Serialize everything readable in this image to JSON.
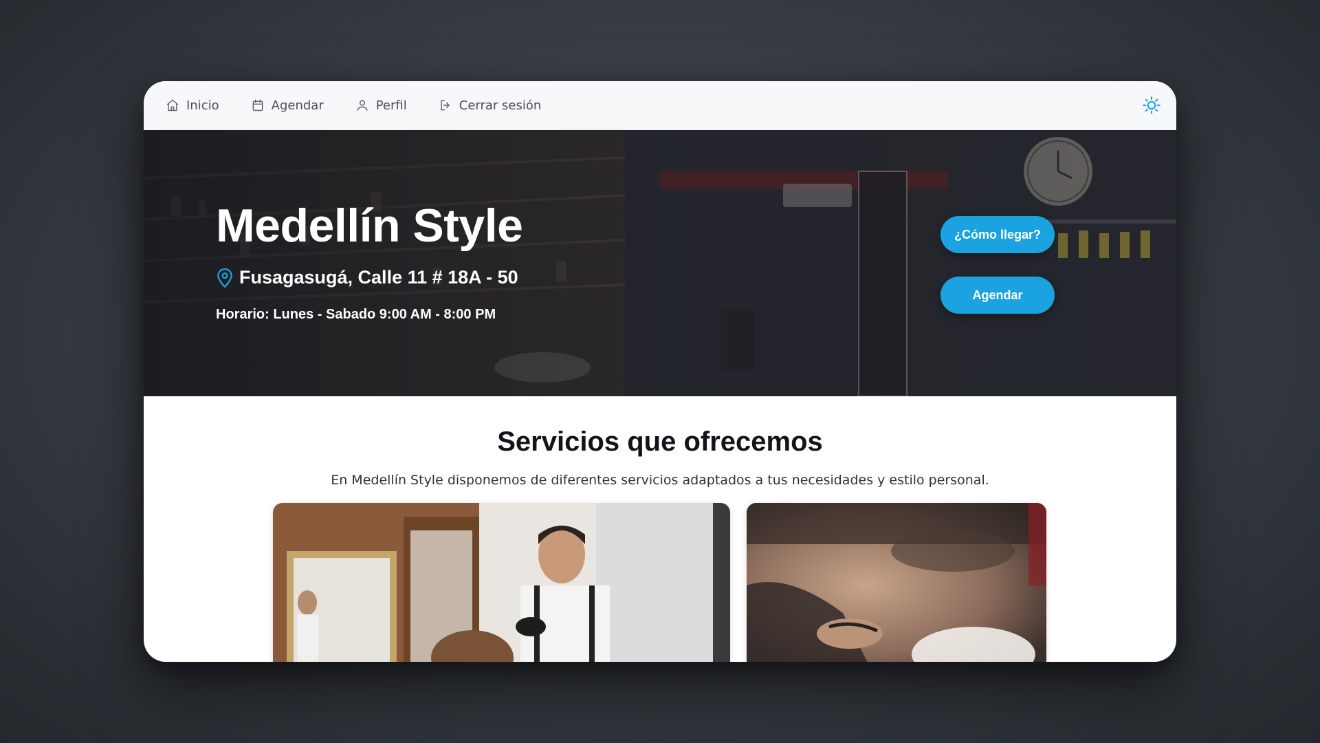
{
  "nav": {
    "items": [
      {
        "label": "Inicio",
        "icon": "home-icon"
      },
      {
        "label": "Agendar",
        "icon": "calendar-icon"
      },
      {
        "label": "Perfil",
        "icon": "user-icon"
      },
      {
        "label": "Cerrar sesión",
        "icon": "logout-icon"
      }
    ],
    "theme_toggle_icon": "sun-icon"
  },
  "hero": {
    "title": "Medellín Style",
    "address": "Fusagasugá, Calle 11 # 18A - 50",
    "address_icon": "map-pin-icon",
    "hours": "Horario: Lunes - Sabado 9:00 AM - 8:00 PM",
    "directions_button": "¿Cómo llegar?",
    "book_button": "Agendar"
  },
  "services": {
    "title": "Servicios que ofrecemos",
    "subtitle": "En Medellín Style disponemos de diferentes servicios adaptados a tus necesidades y estilo personal."
  },
  "colors": {
    "accent": "#1aa3e0",
    "nav_bg": "#f7f8fa",
    "text_dark": "#111418"
  }
}
